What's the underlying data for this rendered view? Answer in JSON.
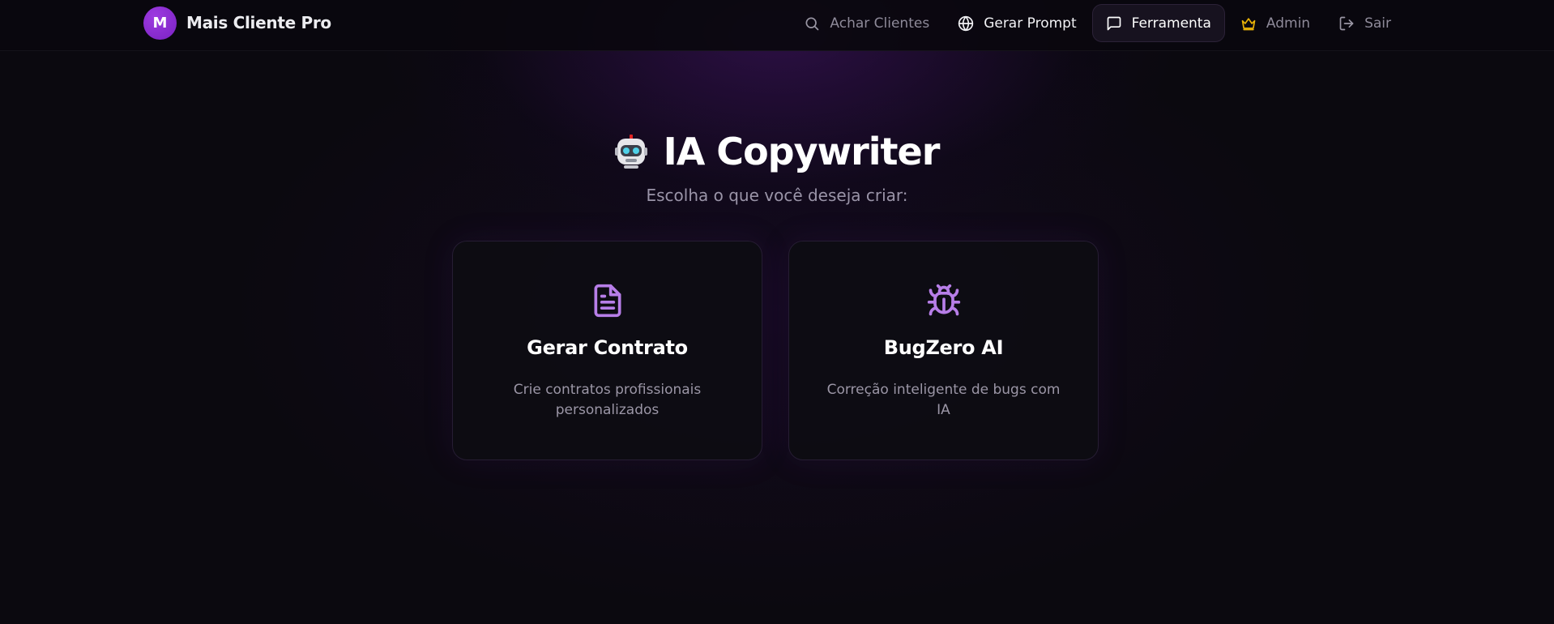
{
  "brand": {
    "initial": "M",
    "name": "Mais Cliente Pro"
  },
  "nav": {
    "items": [
      {
        "label": "Achar Clientes",
        "icon": "search-icon"
      },
      {
        "label": "Gerar Prompt",
        "icon": "globe-icon"
      },
      {
        "label": "Ferramenta",
        "icon": "message-square-icon",
        "active": true
      },
      {
        "label": "Admin",
        "icon": "crown-icon"
      },
      {
        "label": "Sair",
        "icon": "logout-icon"
      }
    ]
  },
  "hero": {
    "emoji_icon": "robot-icon",
    "title": "IA Copywriter",
    "subtitle": "Escolha o que você deseja criar:"
  },
  "cards": [
    {
      "icon": "file-text-icon",
      "title": "Gerar Contrato",
      "description": "Crie contratos profissionais personalizados"
    },
    {
      "icon": "bug-icon",
      "title": "BugZero AI",
      "description": "Correção inteligente de bugs com IA"
    }
  ],
  "colors": {
    "accent": "#9d3ae0",
    "icon_purple": "#b77ee8",
    "crown_gold": "#eab308",
    "background": "#0b090f"
  }
}
